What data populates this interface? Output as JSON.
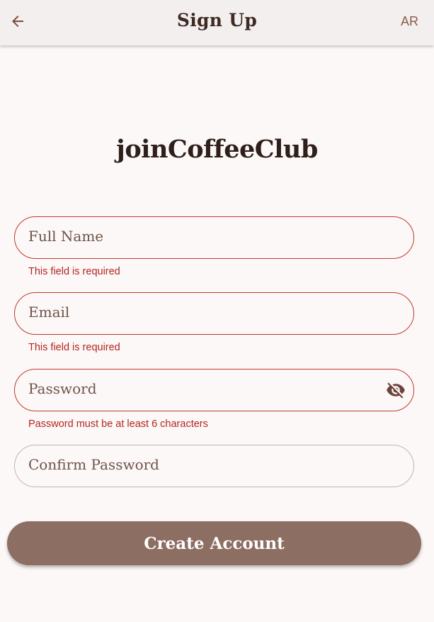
{
  "appbar": {
    "back_icon": "arrow-left-icon",
    "title": "Sign Up",
    "language_toggle": "AR"
  },
  "brand": {
    "text": "joinCoffeeClub"
  },
  "form": {
    "full_name": {
      "placeholder": "Full Name",
      "value": "",
      "error": "This field is required"
    },
    "email": {
      "placeholder": "Email",
      "value": "",
      "error": "This field is required"
    },
    "password": {
      "placeholder": "Password",
      "value": "",
      "error": "Password must be at least 6 characters",
      "toggle_icon": "eye-off-icon"
    },
    "confirm_password": {
      "placeholder": "Confirm Password",
      "value": ""
    },
    "submit_label": "Create Account"
  },
  "colors": {
    "primary": "#8d6e63",
    "error": "#b3261e",
    "background": "#fcf8f8",
    "appbar": "#f3efef"
  }
}
